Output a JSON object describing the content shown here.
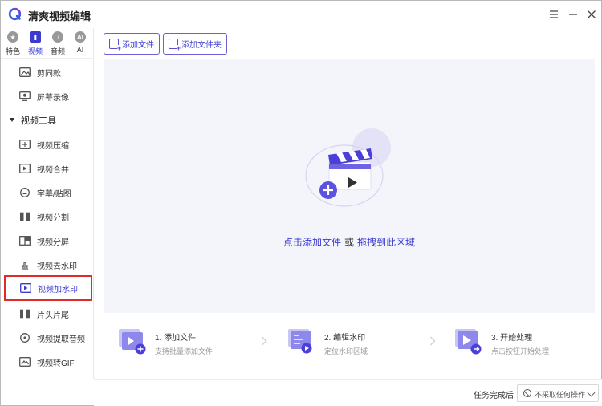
{
  "app": {
    "title": "清爽视频编辑"
  },
  "window_controls": [
    "menu-icon",
    "minimize-icon",
    "close-icon"
  ],
  "sidebar": {
    "tabs": [
      {
        "label": "特色",
        "icon": "star-icon",
        "active": false
      },
      {
        "label": "视频",
        "icon": "film-icon",
        "active": true
      },
      {
        "label": "音频",
        "icon": "music-icon",
        "active": false
      },
      {
        "label": "AI",
        "icon": "ai-icon",
        "active": false
      }
    ],
    "items_top": [
      {
        "label": "剪同款",
        "icon": "image-icon"
      },
      {
        "label": "屏幕录像",
        "icon": "screen-record-icon"
      }
    ],
    "group": {
      "label": "视频工具",
      "expanded": true
    },
    "items": [
      {
        "label": "视频压缩",
        "icon": "compress-icon"
      },
      {
        "label": "视频合并",
        "icon": "merge-icon"
      },
      {
        "label": "字幕/贴图",
        "icon": "subtitle-icon"
      },
      {
        "label": "视频分割",
        "icon": "split-icon"
      },
      {
        "label": "视频分屏",
        "icon": "split-screen-icon"
      },
      {
        "label": "视频去水印",
        "icon": "remove-watermark-icon"
      },
      {
        "label": "视频加水印",
        "icon": "add-watermark-icon",
        "selected": true
      },
      {
        "label": "片头片尾",
        "icon": "intro-outro-icon"
      },
      {
        "label": "视频提取音频",
        "icon": "extract-audio-icon"
      },
      {
        "label": "视频转GIF",
        "icon": "gif-icon"
      }
    ]
  },
  "toolbar": {
    "add_file": "添加文件",
    "add_folder": "添加文件夹"
  },
  "dropzone": {
    "click_text": "点击添加文件",
    "or_text": "或",
    "drag_text": "拖拽到此区域"
  },
  "steps": [
    {
      "title": "1. 添加文件",
      "desc": "支持批量添加文件",
      "icon": "add-file-step-icon"
    },
    {
      "title": "2. 编辑水印",
      "desc": "定位水印区域",
      "icon": "edit-watermark-step-icon"
    },
    {
      "title": "3. 开始处理",
      "desc": "点击按钮开始处理",
      "icon": "start-process-step-icon"
    }
  ],
  "statusbar": {
    "after_label": "任务完成后",
    "after_value": "不采取任何操作"
  },
  "colors": {
    "accent": "#3b3bcf",
    "highlight_border": "#e02b2b",
    "dropzone_bg": "#f4f4fb"
  }
}
